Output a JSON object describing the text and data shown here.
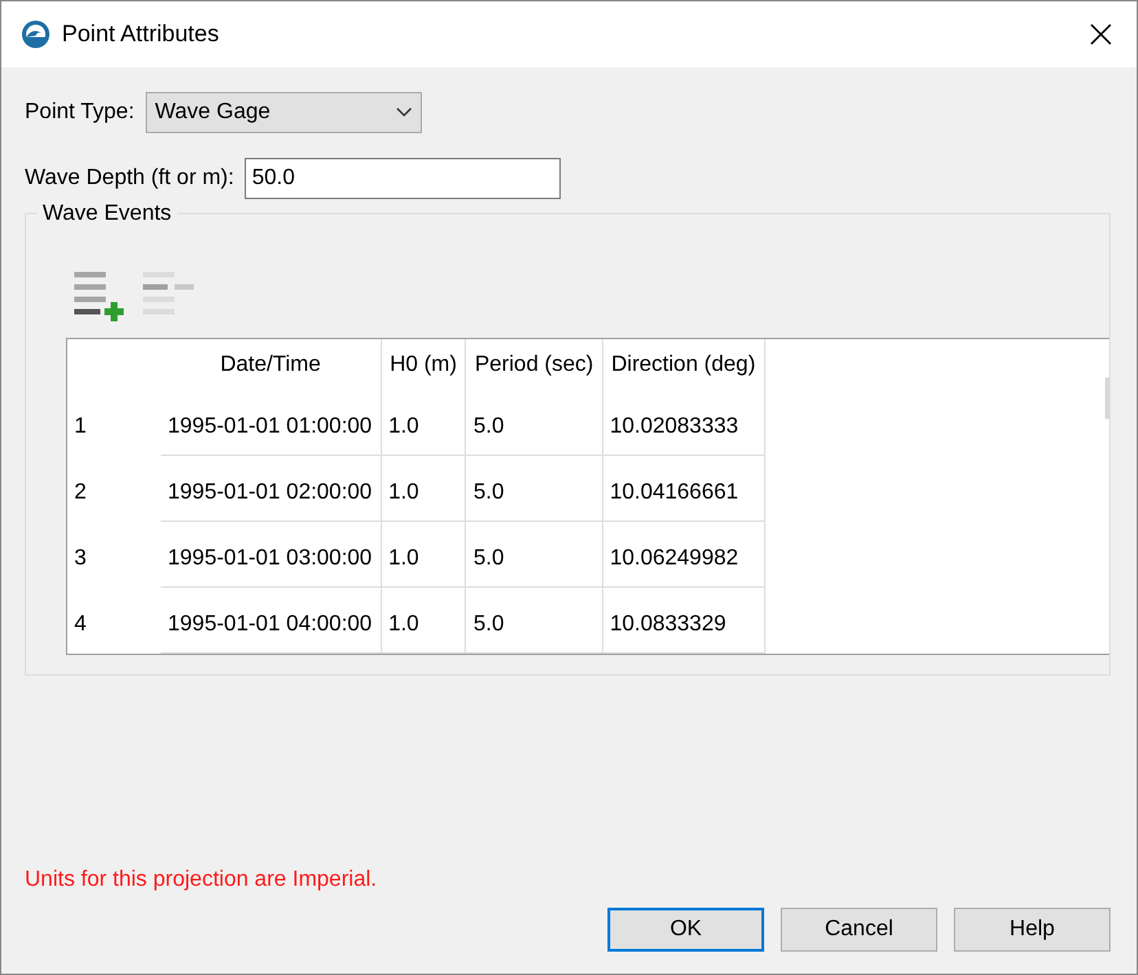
{
  "window": {
    "title": "Point Attributes"
  },
  "point_type": {
    "label": "Point Type:",
    "value": "Wave Gage"
  },
  "wave_depth": {
    "label": "Wave Depth (ft or m):",
    "value": "50.0"
  },
  "wave_events": {
    "title": "Wave Events",
    "toolbar": [
      {
        "kind": "add",
        "disabled": false
      },
      {
        "kind": "remove",
        "disabled": true
      }
    ],
    "table": {
      "columns": [
        "Date/Time",
        "H0 (m)",
        "Period (sec)",
        "Direction (deg)"
      ],
      "rows": [
        {
          "index": "1",
          "cells": [
            "1995-01-01 01:00:00",
            "1.0",
            "5.0",
            "10.02083333"
          ]
        },
        {
          "index": "2",
          "cells": [
            "1995-01-01 02:00:00",
            "1.0",
            "5.0",
            "10.04166661"
          ]
        },
        {
          "index": "3",
          "cells": [
            "1995-01-01 03:00:00",
            "1.0",
            "5.0",
            "10.06249982"
          ]
        },
        {
          "index": "4",
          "cells": [
            "1995-01-01 04:00:00",
            "1.0",
            "5.0",
            "10.0833329"
          ]
        }
      ]
    }
  },
  "message": "Units for this projection are Imperial.",
  "buttons": [
    {
      "label": "OK",
      "default": true
    },
    {
      "label": "Cancel",
      "default": false
    },
    {
      "label": "Help",
      "default": false
    }
  ]
}
